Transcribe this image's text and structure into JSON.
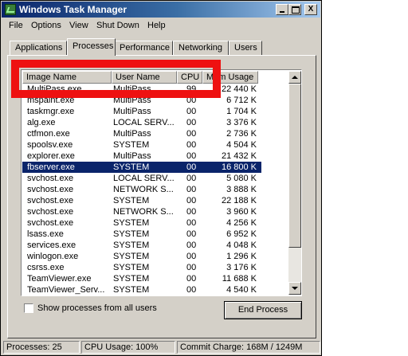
{
  "window": {
    "title": "Windows Task Manager",
    "app_icon": "task-manager-icon"
  },
  "title_buttons": {
    "minimize": "",
    "maximize": "",
    "close": "X"
  },
  "menu": [
    "File",
    "Options",
    "View",
    "Shut Down",
    "Help"
  ],
  "tabs": [
    "Applications",
    "Processes",
    "Performance",
    "Networking",
    "Users"
  ],
  "active_tab": "Processes",
  "columns": {
    "image_name": "Image Name",
    "user_name": "User Name",
    "cpu": "CPU",
    "mem_usage": "Mem Usage"
  },
  "processes": [
    {
      "image": "MultiPass.exe",
      "user": "MultiPass",
      "cpu": "99",
      "mem": "22 440 K"
    },
    {
      "image": "mspaint.exe",
      "user": "MultiPass",
      "cpu": "00",
      "mem": "6 712 K"
    },
    {
      "image": "taskmgr.exe",
      "user": "MultiPass",
      "cpu": "00",
      "mem": "1 704 K"
    },
    {
      "image": "alg.exe",
      "user": "LOCAL SERV...",
      "cpu": "00",
      "mem": "3 376 K"
    },
    {
      "image": "ctfmon.exe",
      "user": "MultiPass",
      "cpu": "00",
      "mem": "2 736 K"
    },
    {
      "image": "spoolsv.exe",
      "user": "SYSTEM",
      "cpu": "00",
      "mem": "4 504 K"
    },
    {
      "image": "explorer.exe",
      "user": "MultiPass",
      "cpu": "00",
      "mem": "21 432 K"
    },
    {
      "image": "fbserver.exe",
      "user": "SYSTEM",
      "cpu": "00",
      "mem": "16 800 K",
      "selected": true
    },
    {
      "image": "svchost.exe",
      "user": "LOCAL SERV...",
      "cpu": "00",
      "mem": "5 080 K"
    },
    {
      "image": "svchost.exe",
      "user": "NETWORK S...",
      "cpu": "00",
      "mem": "3 888 K"
    },
    {
      "image": "svchost.exe",
      "user": "SYSTEM",
      "cpu": "00",
      "mem": "22 188 K"
    },
    {
      "image": "svchost.exe",
      "user": "NETWORK S...",
      "cpu": "00",
      "mem": "3 960 K"
    },
    {
      "image": "svchost.exe",
      "user": "SYSTEM",
      "cpu": "00",
      "mem": "4 256 K"
    },
    {
      "image": "lsass.exe",
      "user": "SYSTEM",
      "cpu": "00",
      "mem": "6 952 K"
    },
    {
      "image": "services.exe",
      "user": "SYSTEM",
      "cpu": "00",
      "mem": "4 048 K"
    },
    {
      "image": "winlogon.exe",
      "user": "SYSTEM",
      "cpu": "00",
      "mem": "1 296 K"
    },
    {
      "image": "csrss.exe",
      "user": "SYSTEM",
      "cpu": "00",
      "mem": "3 176 K"
    },
    {
      "image": "TeamViewer.exe",
      "user": "SYSTEM",
      "cpu": "00",
      "mem": "11 688 K"
    },
    {
      "image": "TeamViewer_Serv...",
      "user": "SYSTEM",
      "cpu": "00",
      "mem": "4 540 K"
    }
  ],
  "show_all_label": "Show processes from all users",
  "show_all_checked": false,
  "end_process_label": "End Process",
  "status": {
    "processes": "Processes: 25",
    "cpu": "CPU Usage: 100%",
    "commit": "Commit Charge: 168M / 1249M"
  },
  "colors": {
    "title_start": "#0a246a",
    "title_end": "#a6caf0",
    "selection": "#0a246a",
    "highlight_box": "#e11111",
    "face": "#d4d0c8"
  }
}
